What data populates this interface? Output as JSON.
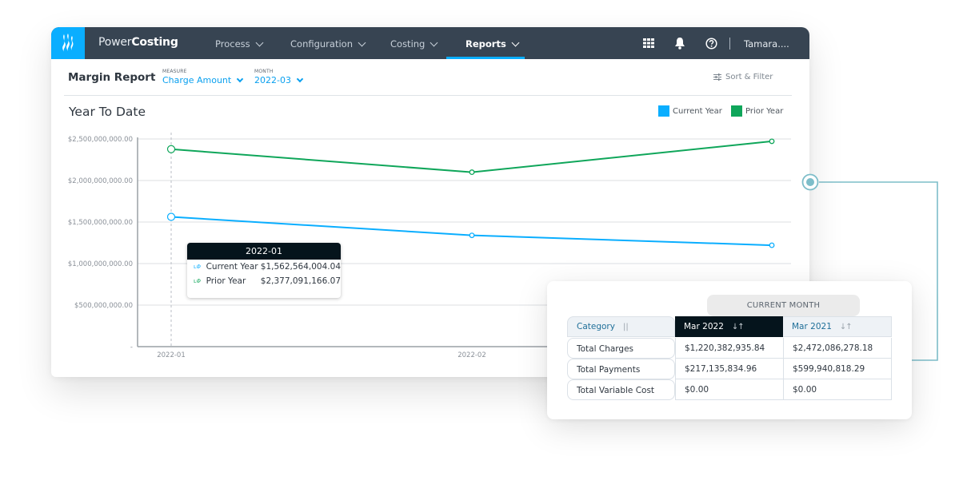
{
  "app": {
    "brand_light": "Power",
    "brand_bold": "Costing",
    "nav": [
      {
        "label": "Process",
        "active": false
      },
      {
        "label": "Configuration",
        "active": false
      },
      {
        "label": "Costing",
        "active": false
      },
      {
        "label": "Reports",
        "active": true
      }
    ],
    "icons": [
      "grid-apps-icon",
      "bell-icon",
      "help-icon"
    ],
    "user": "Tamara...."
  },
  "report": {
    "title": "Margin Report",
    "measure_label": "MEASURE",
    "measure_value": "Charge Amount",
    "month_label": "MONTH",
    "month_value": "2022-03",
    "sort_filter": "Sort & Filter",
    "section_title": "Year To Date"
  },
  "colors": {
    "current_year": "#0aaeff",
    "prior_year": "#0fa65a",
    "accent": "#0aaeff",
    "navbar": "#374452",
    "connector": "#7dbdc9"
  },
  "chart_data": {
    "type": "line",
    "title": "Year To Date",
    "x": [
      "2022-01",
      "2022-02",
      "2022-03"
    ],
    "x_tick_labels": [
      "2022-01",
      "2022-02"
    ],
    "series": [
      {
        "name": "Current Year",
        "color": "#0aaeff",
        "values": [
          1562564004.04,
          1340000000,
          1220382935.84
        ]
      },
      {
        "name": "Prior Year",
        "color": "#0fa65a",
        "values": [
          2377091166.07,
          2100000000,
          2472086278.18
        ]
      }
    ],
    "ylim": [
      0,
      2500000000
    ],
    "y_ticks": [
      0,
      500000000,
      1000000000,
      1500000000,
      2000000000,
      2500000000
    ],
    "y_tick_labels": [
      "-",
      "$500,000,000.00",
      "$1,000,000,000.00",
      "$1,500,000,000.00",
      "$2,000,000,000.00",
      "$2,500,000,000.00"
    ],
    "xlabel": "",
    "ylabel": "",
    "grid": true,
    "legend": "top-right",
    "tooltip": {
      "title": "2022-01",
      "rows": [
        {
          "icon": "line-chart-icon",
          "name": "Current Year",
          "value": "$1,562,564,004.04"
        },
        {
          "icon": "line-chart-icon",
          "name": "Prior Year",
          "value": "$2,377,091,166.07"
        }
      ]
    }
  },
  "table": {
    "group_header": "CURRENT MONTH",
    "columns": [
      "Category",
      "Mar 2022",
      "Mar 2021"
    ],
    "rows": [
      [
        "Total Charges",
        "$1,220,382,935.84",
        "$2,472,086,278.18"
      ],
      [
        "Total Payments",
        "$217,135,834.96",
        "$599,940,818.29"
      ],
      [
        "Total Variable Cost",
        "$0.00",
        "$0.00"
      ]
    ]
  }
}
